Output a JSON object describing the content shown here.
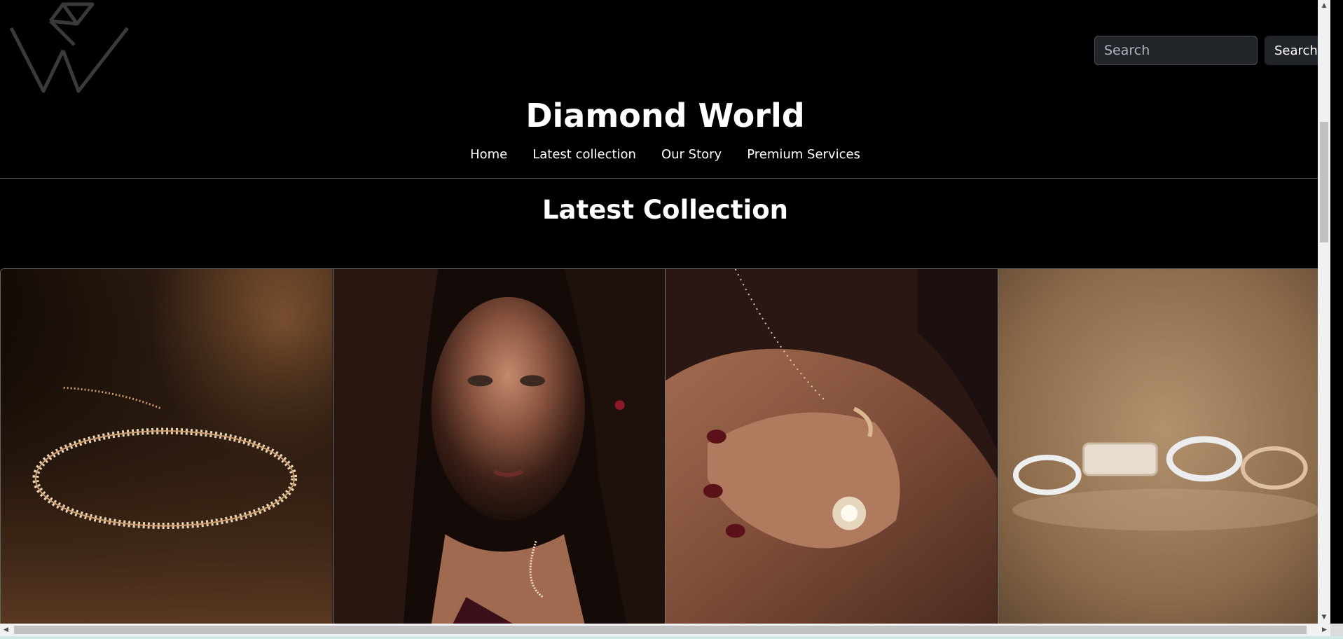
{
  "header": {
    "logo_icon": "diamond-w-logo-icon",
    "search": {
      "placeholder": "Search",
      "button_label": "Search"
    },
    "brand_title": "Diamond World",
    "nav": [
      {
        "label": "Home"
      },
      {
        "label": "Latest collection"
      },
      {
        "label": "Our Story"
      },
      {
        "label": "Premium Services"
      }
    ]
  },
  "main": {
    "section_title": "Latest Collection",
    "gallery": [
      {
        "subject": "gold-diamond-tennis-bracelet-image"
      },
      {
        "subject": "model-ruby-jewelry-portrait-image"
      },
      {
        "subject": "hand-diamond-rings-on-shoulder-image"
      },
      {
        "subject": "four-diamond-rings-image"
      }
    ]
  },
  "colors": {
    "background": "#000000",
    "input_bg": "#212529",
    "text": "#ffffff"
  }
}
